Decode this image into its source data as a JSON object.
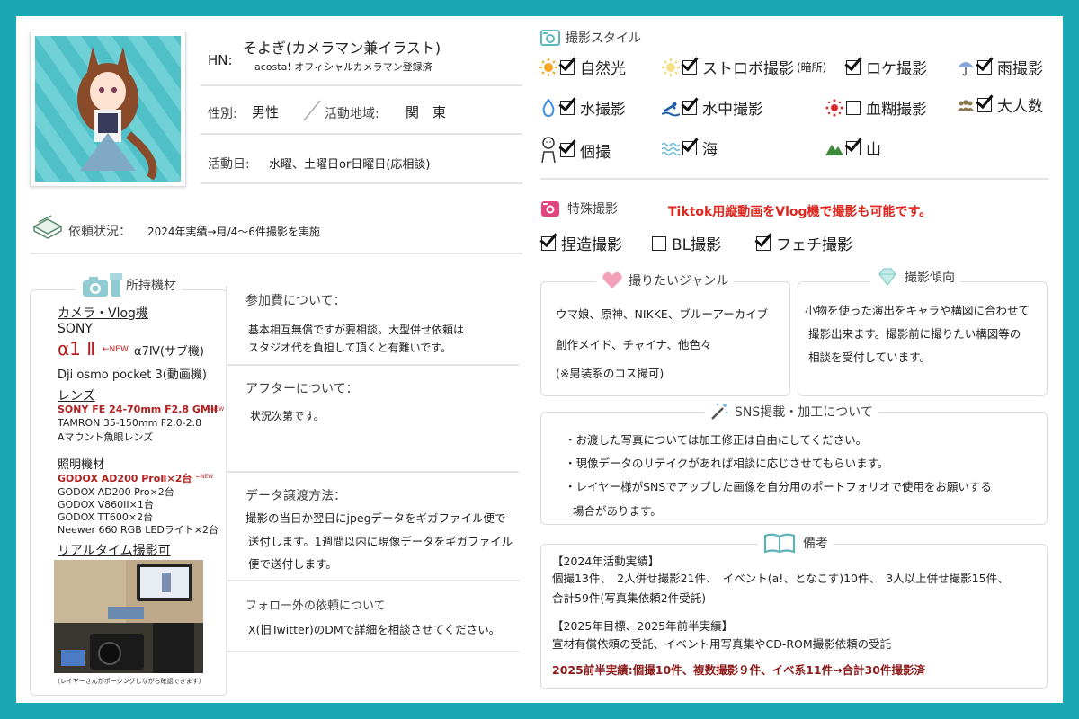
{
  "profile": {
    "hn_label": "HN:",
    "name": "そよぎ(カメラマン兼イラスト)",
    "subtitle": "acosta! オフィシャルカメラマン登録済",
    "gender_label": "性別:",
    "gender": "男性",
    "area_label": "活動地域:",
    "area": "関　東",
    "days_label": "活動日:",
    "days": "水曜、土曜日or日曜日(応相談)"
  },
  "requests": {
    "label": "依頼状況：",
    "value": "2024年実績→月/4～6件撮影を実施"
  },
  "equipment": {
    "title": "所持機材",
    "camera_heading": "カメラ・Vlog機",
    "brand": "SONY",
    "main_camera": "α1 Ⅱ",
    "new_tag": "←NEW",
    "sub_camera": "α7Ⅳ(サブ機)",
    "vlog": "Dji osmo pocket 3(動画機)",
    "lens_heading": "レンズ",
    "lens_new": "SONY FE 24-70mm F2.8 GMII",
    "lens_2": "TAMRON 35-150mm F2.0-2.8",
    "lens_3": "Aマウント魚眼レンズ",
    "light_heading": "照明機材",
    "light_new": "GODOX AD200 ProⅡ×2台",
    "light_2": "GODOX AD200 Pro×2台",
    "light_3": "GODOX V860II×1台",
    "light_4": "GODOX TT600×2台",
    "light_5": "Neewer 660 RGB LEDライト×2台",
    "realtime_heading": "リアルタイム撮影可",
    "photo_caption": "（レイヤーさんがポージングしながら確認できます）"
  },
  "fees": {
    "title": "参加費について：",
    "line1": "基本相互無償ですが要相談。大型併せ依頼は",
    "line2": "スタジオ代を負担して頂くと有難いです。"
  },
  "after": {
    "title": "アフターについて：",
    "text": "状況次第です。"
  },
  "data_transfer": {
    "title": "データ譲渡方法：",
    "line1": "撮影の当日か翌日にjpegデータをギガファイル便で",
    "line2": "送付します。1週間以内に現像データをギガファイル",
    "line3": "便で送付します。"
  },
  "non_follower": {
    "title": "フォロー外の依頼について",
    "text": "X(旧Twitter)のDMで詳細を相談させてください。"
  },
  "styles": {
    "title": "撮影スタイル",
    "items": [
      {
        "label": "自然光",
        "checked": true,
        "icon": "sun-icon"
      },
      {
        "label": "ストロボ撮影",
        "suffix": "(暗所)",
        "checked": true,
        "icon": "strobe-icon"
      },
      {
        "label": "ロケ撮影",
        "checked": true,
        "icon": ""
      },
      {
        "label": "雨撮影",
        "checked": true,
        "icon": "umbrella-icon"
      },
      {
        "label": "水撮影",
        "checked": true,
        "icon": "water-drop-icon"
      },
      {
        "label": "水中撮影",
        "checked": true,
        "icon": "swim-icon"
      },
      {
        "label": "血糊撮影",
        "checked": false,
        "icon": "splatter-icon"
      },
      {
        "label": "大人数",
        "checked": true,
        "icon": "group-icon"
      },
      {
        "label": "個撮",
        "checked": true,
        "icon": "person-icon"
      },
      {
        "label": "海",
        "checked": true,
        "icon": "wave-icon"
      },
      {
        "label": "山",
        "checked": true,
        "icon": "mountain-icon"
      }
    ]
  },
  "special": {
    "title": "特殊撮影",
    "note": "Tiktok用縦動画をVlog機で撮影も可能です。",
    "items": [
      {
        "label": "捏造撮影",
        "checked": true
      },
      {
        "label": "BL撮影",
        "checked": false
      },
      {
        "label": "フェチ撮影",
        "checked": true
      }
    ]
  },
  "genres": {
    "title": "撮りたいジャンル",
    "line1": "ウマ娘、原神、NIKKE、ブルーアーカイブ",
    "line2": "創作メイド、チャイナ、他色々",
    "line3": "(※男装系のコス撮可)"
  },
  "tendency": {
    "title": "撮影傾向",
    "line1": "小物を使った演出をキャラや構図に合わせて",
    "line2": "撮影出来ます。撮影前に撮りたい構図等の",
    "line3": "相談を受付しています。"
  },
  "sns": {
    "title": "SNS掲載・加工について",
    "line1": "・お渡した写真については加工修正は自由にしてください。",
    "line2": "・現像データのリテイクがあれば相談に応じさせてもらいます。",
    "line3": "・レイヤー様がSNSでアップした画像を自分用のポートフォリオで使用をお願いする",
    "line4": "場合があります。"
  },
  "notes": {
    "title": "備考",
    "h1": "【2024年活動実績】",
    "l1": "個撮13件、　2人併せ撮影21件、　イベント(a!、となこす)10件、　3人以上併せ撮影15件、",
    "l2": "合計59件(写真集依頼2件受託)",
    "h2": "【2025年目標、2025年前半実績】",
    "l3": "宣材有償依頼の受託、イベント用写真集やCD-ROM撮影依頼の受託",
    "l4": "2025前半実績:個撮10件、複数撮影９件、イベ系11件→合計30件撮影済"
  },
  "colors": {
    "frame": "#1aa9b4",
    "accent_red": "#e0261d",
    "dark_red": "#8d1a1a"
  }
}
